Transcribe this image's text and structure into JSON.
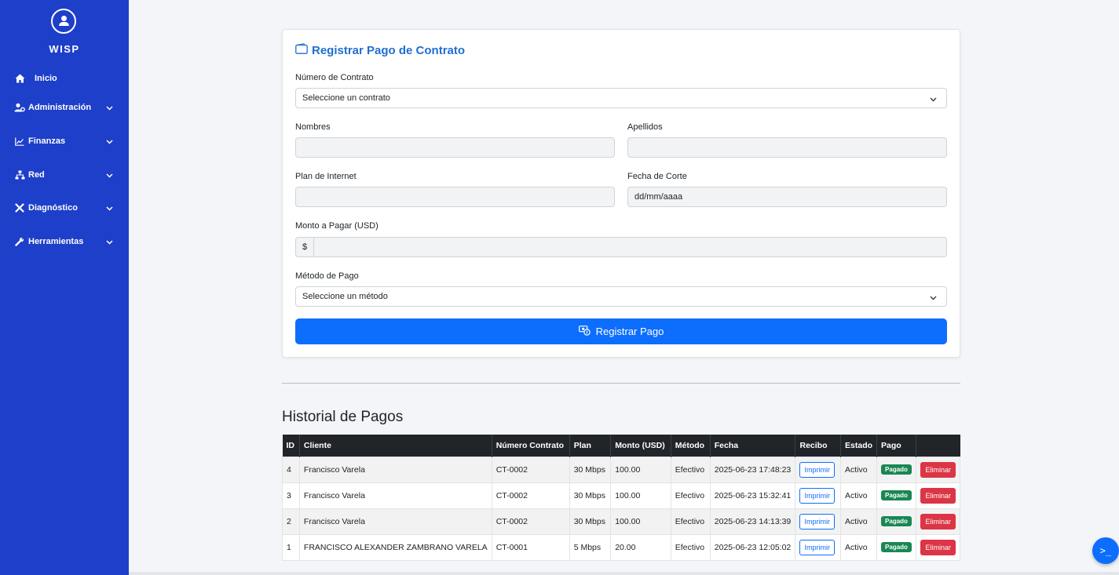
{
  "sidebar": {
    "brand": "WISP",
    "items": [
      {
        "label": "Inicio",
        "icon": "home-icon",
        "has_submenu": false
      },
      {
        "label": "Administración",
        "icon": "user-cog-icon",
        "has_submenu": true
      },
      {
        "label": "Finanzas",
        "icon": "chart-line-icon",
        "has_submenu": true
      },
      {
        "label": "Red",
        "icon": "network-icon",
        "has_submenu": true
      },
      {
        "label": "Diagnóstico",
        "icon": "tools-icon",
        "has_submenu": true
      },
      {
        "label": "Herramientas",
        "icon": "wrench-icon",
        "has_submenu": true
      }
    ]
  },
  "form": {
    "title": "Registrar Pago de Contrato",
    "contract_label": "Número de Contrato",
    "contract_value": "Seleccione un contrato",
    "names_label": "Nombres",
    "names_value": "",
    "lastnames_label": "Apellidos",
    "lastnames_value": "",
    "plan_label": "Plan de Internet",
    "plan_value": "",
    "cutoff_label": "Fecha de Corte",
    "cutoff_placeholder": "dd/mm/aaaa",
    "amount_label": "Monto a Pagar (USD)",
    "amount_prefix": "$",
    "amount_value": "",
    "method_label": "Método de Pago",
    "method_value": "Seleccione un método",
    "submit_label": "Registrar Pago"
  },
  "history": {
    "title": "Historial de Pagos",
    "columns": [
      "ID",
      "Cliente",
      "Número Contrato",
      "Plan",
      "Monto (USD)",
      "Método",
      "Fecha",
      "Recibo",
      "Estado",
      "Pago",
      ""
    ],
    "rows": [
      {
        "id": "4",
        "cliente": "Francisco Varela",
        "contrato": "CT-0002",
        "plan": "30 Mbps",
        "monto": "100.00",
        "metodo": "Efectivo",
        "fecha": "2025-06-23 17:48:23",
        "recibo": "Imprimir",
        "estado": "Activo",
        "pago": "Pagado",
        "accion": "Eliminar"
      },
      {
        "id": "3",
        "cliente": "Francisco Varela",
        "contrato": "CT-0002",
        "plan": "30 Mbps",
        "monto": "100.00",
        "metodo": "Efectivo",
        "fecha": "2025-06-23 15:32:41",
        "recibo": "Imprimir",
        "estado": "Activo",
        "pago": "Pagado",
        "accion": "Eliminar"
      },
      {
        "id": "2",
        "cliente": "Francisco Varela",
        "contrato": "CT-0002",
        "plan": "30 Mbps",
        "monto": "100.00",
        "metodo": "Efectivo",
        "fecha": "2025-06-23 14:13:39",
        "recibo": "Imprimir",
        "estado": "Activo",
        "pago": "Pagado",
        "accion": "Eliminar"
      },
      {
        "id": "1",
        "cliente": "FRANCISCO ALEXANDER ZAMBRANO VARELA",
        "contrato": "CT-0001",
        "plan": "5 Mbps",
        "monto": "20.00",
        "metodo": "Efectivo",
        "fecha": "2025-06-23 12:05:02",
        "recibo": "Imprimir",
        "estado": "Activo",
        "pago": "Pagado",
        "accion": "Eliminar"
      }
    ]
  },
  "terminal_button": ">_",
  "colors": {
    "sidebar": "#1d3fc9",
    "primary": "#0d6efd",
    "success": "#198754",
    "danger": "#dc3545",
    "table_header": "#212529"
  }
}
